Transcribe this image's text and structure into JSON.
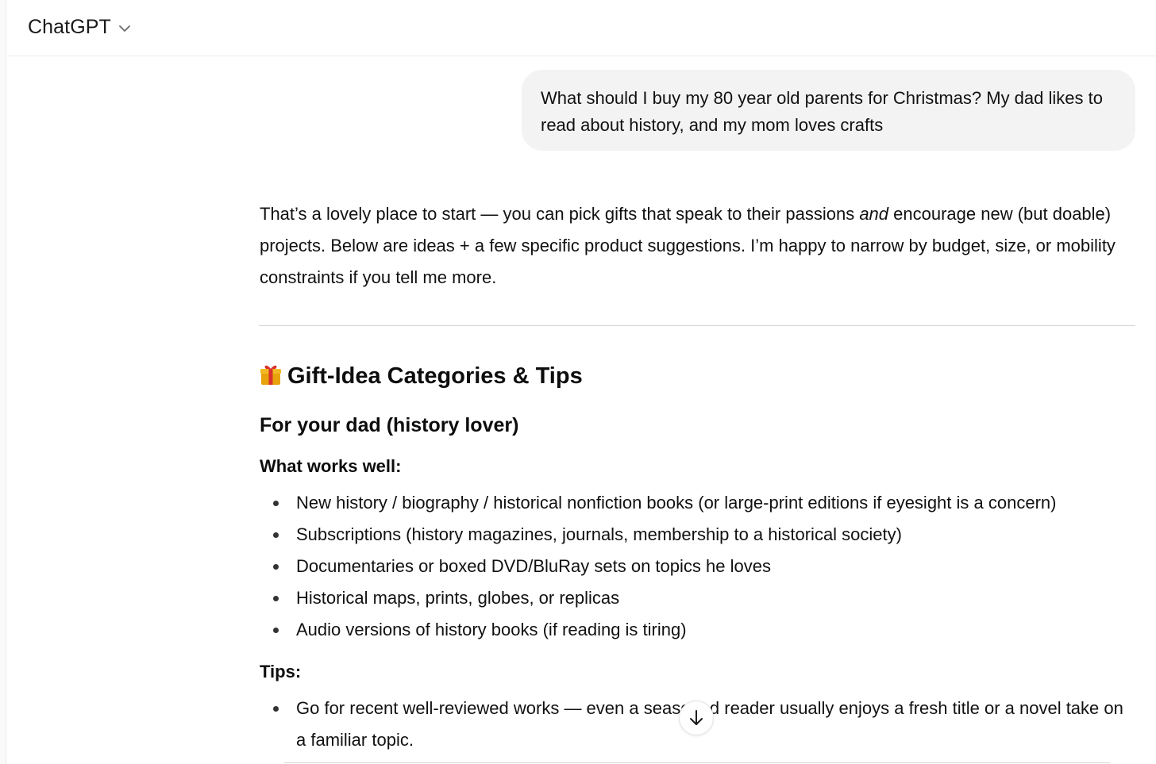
{
  "header": {
    "model_name": "ChatGPT",
    "chevron_icon": "chevron-down-icon"
  },
  "user_message": {
    "text": "What should I buy my 80 year old parents for Christmas? My dad likes to read about history, and my mom loves crafts"
  },
  "assistant": {
    "intro_part1": "That’s a lovely place to start — you can pick gifts that speak to their passions ",
    "intro_emphasis": "and",
    "intro_part2": " encourage new (but doable) projects. Below are ideas + a few specific product suggestions. I’m happy to narrow by budget, size, or mobility constraints if you tell me more.",
    "section_icon": "gift-icon",
    "section_title": "Gift-Idea Categories & Tips",
    "subsection_title": "For your dad (history lover)",
    "works_label": "What works well:",
    "works_items": [
      "New history / biography / historical nonfiction books (or large-print editions if eyesight is a concern)",
      "Subscriptions (history magazines, journals, membership to a historical society)",
      "Documentaries or boxed DVD/BluRay sets on topics he loves",
      "Historical maps, prints, globes, or replicas",
      "Audio versions of history books (if reading is tiring)"
    ],
    "tips_label": "Tips:",
    "tips_items": [
      "Go for recent well-reviewed works — even a seasoned reader usually enjoys a fresh title or a novel take on a familiar topic."
    ]
  },
  "scroll_button_icon": "arrow-down-icon"
}
